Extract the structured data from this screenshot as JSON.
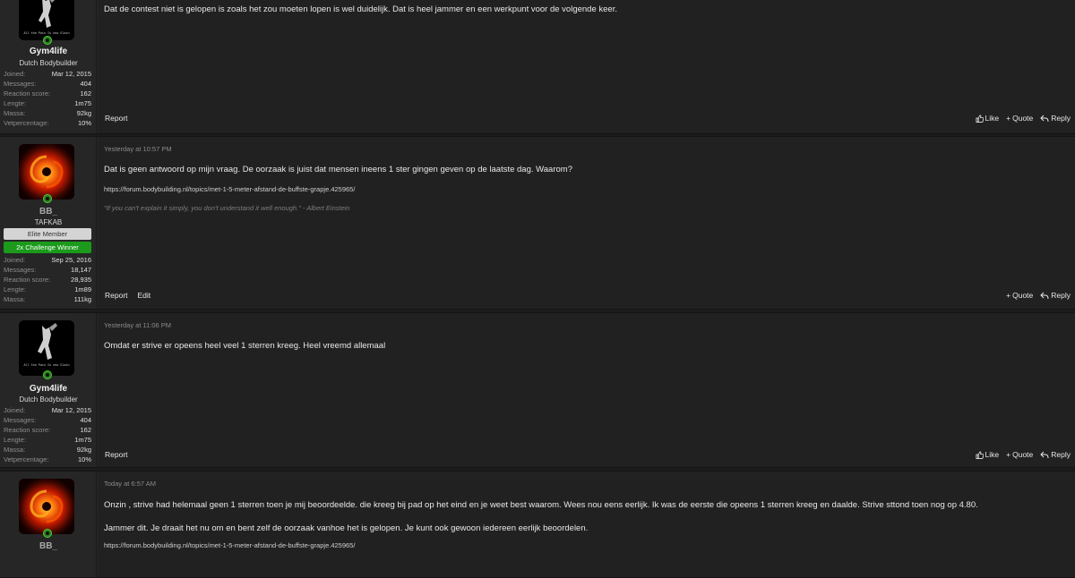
{
  "actions": {
    "report": "Report",
    "edit": "Edit",
    "like": "Like",
    "quote": "Quote",
    "reply": "Reply"
  },
  "stat_labels": {
    "joined": "Joined:",
    "messages": "Messages:",
    "reaction": "Reaction score:",
    "lengte": "Lengte:",
    "massa": "Massa:",
    "vet": "Vetpercentage:"
  },
  "posts": [
    {
      "user": {
        "name": "Gym4life",
        "title": "Dutch Bodybuilder",
        "avatar_caption": "All the Pain Is new Glain",
        "joined": "Mar 12, 2015",
        "messages": "404",
        "reaction": "162",
        "lengte": "1m75",
        "massa": "92kg",
        "vet": "10%"
      },
      "message": "Dat de contest niet is gelopen is zoals het zou moeten lopen is wel duidelijk. Dat is heel jammer en een werkpunt voor de volgende keer."
    },
    {
      "user": {
        "name": "BB_",
        "title": "TAFKAB",
        "badge_elite": "Elite Member",
        "badge_challenge": "2x Challenge Winner",
        "joined": "Sep 25, 2016",
        "messages": "18,147",
        "reaction": "28,935",
        "lengte": "1m89",
        "massa": "111kg"
      },
      "time": "Yesterday at 10:57 PM",
      "message": "Dat is geen antwoord op mijn vraag. De oorzaak is juist dat mensen ineens 1 ster gingen geven op de laatste dag. Waarom?",
      "sig_link": "https://forum.bodybuilding.nl/topics/met-1-5-meter-afstand-de-buffste-grapje.425965/",
      "sig_quote": "\"If you can't explain it simply, you don't understand it well enough.\" - Albert Einstein"
    },
    {
      "user": {
        "name": "Gym4life",
        "title": "Dutch Bodybuilder",
        "avatar_caption": "All the Pain Is new Glain",
        "joined": "Mar 12, 2015",
        "messages": "404",
        "reaction": "162",
        "lengte": "1m75",
        "massa": "92kg",
        "vet": "10%"
      },
      "time": "Yesterday at 11:06 PM",
      "message": "Omdat er strive er opeens heel veel 1 sterren kreeg. Heel vreemd allemaal"
    },
    {
      "user": {
        "name": "BB_"
      },
      "time": "Today at 6:57 AM",
      "message": "Onzin , strive had helemaal geen 1 sterren toen je mij beoordeelde. die kreeg bij pad op het eind en je weet best waarom. Wees nou eens eerlijk. Ik was de eerste die opeens 1 sterren kreeg en daalde. Strive sttond toen nog op 4.80.",
      "message2": "Jammer dit. Je draait het nu om en bent zelf de oorzaak vanhoe het is gelopen. Je kunt ook gewoon iedereen eerlijk beoordelen.",
      "sig_link": "https://forum.bodybuilding.nl/topics/met-1-5-meter-afstand-de-buffste-grapje.425965/"
    }
  ]
}
